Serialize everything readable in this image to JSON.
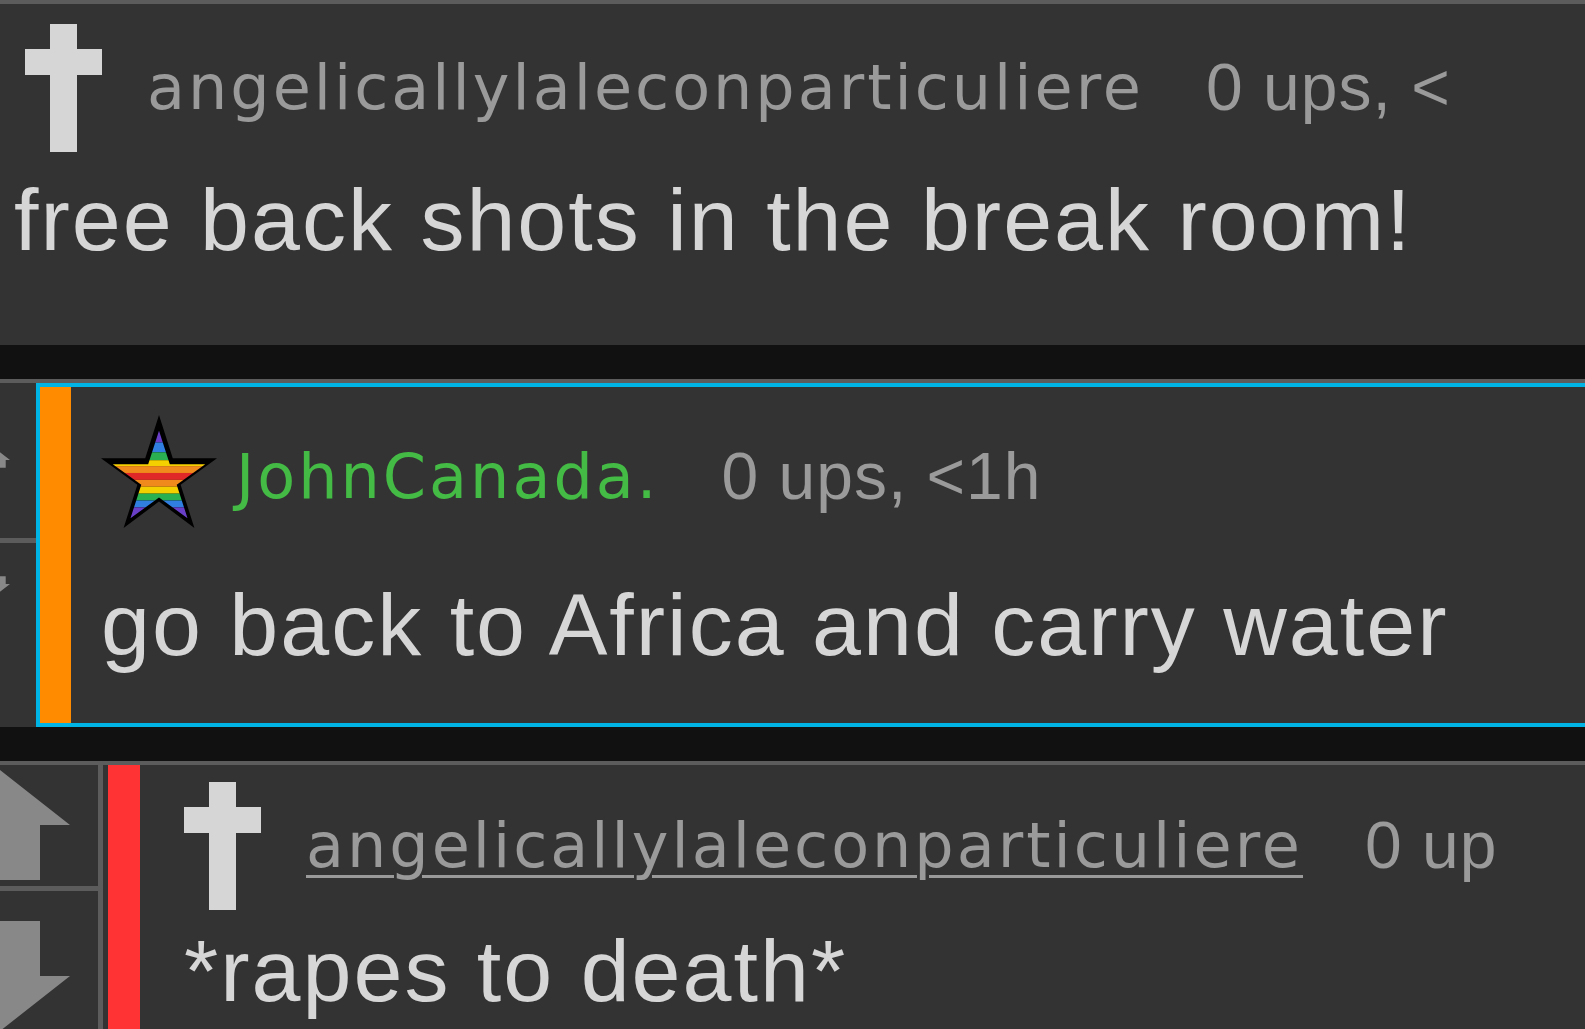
{
  "comments": [
    {
      "vote_buttons": false,
      "selected": false,
      "badge": {
        "kind": "cross"
      },
      "username": {
        "text": "angelicallylaleconparticuliere",
        "color": "#9a9a9a",
        "underlined": false
      },
      "meta": "0 ups, <",
      "body": "free back shots in the break room!"
    },
    {
      "vote_buttons": true,
      "selected": true,
      "color": "#ff8c00",
      "badge": {
        "kind": "star"
      },
      "username": {
        "text": "JohnCanada.",
        "color": "#44bb44",
        "underlined": false
      },
      "meta": "0 ups, <1h",
      "body": "go back to Africa and carry water"
    },
    {
      "vote_buttons": true,
      "selected": false,
      "color": "#ff3333",
      "badge": {
        "kind": "cross"
      },
      "username": {
        "text": "angelicallylaleconparticuliere",
        "color": "#9a9a9a",
        "underlined": true
      },
      "meta": "0 up",
      "body": "*rapes to death*"
    }
  ]
}
